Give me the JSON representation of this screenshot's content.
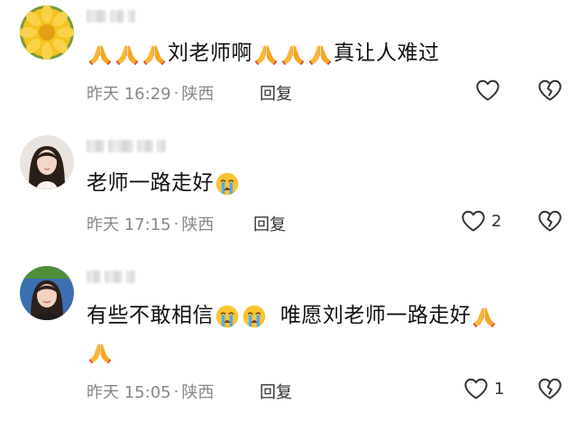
{
  "comments": [
    {
      "segments": [
        "",
        "刘老师啊",
        "",
        "真让人难过"
      ],
      "time": "昨天 16:29",
      "location": "陕西",
      "reply_label": "回复",
      "like_count": ""
    },
    {
      "segments": [
        "老师一路走好"
      ],
      "time": "昨天 17:15",
      "location": "陕西",
      "reply_label": "回复",
      "like_count": "2"
    },
    {
      "segments": [
        "有些不敢相信",
        "唯愿刘老师一路走好"
      ],
      "time": "昨天 15:05",
      "location": "陕西",
      "reply_label": "回复",
      "like_count": "1"
    }
  ],
  "meta_separator": "·",
  "icons": {
    "like": "heart-outline-icon",
    "dislike": "broken-heart-icon",
    "pray": "folded-hands-emoji",
    "cry": "loudly-crying-emoji"
  },
  "colors": {
    "meta": "#888888",
    "text": "#111111",
    "icon": "#333333"
  }
}
